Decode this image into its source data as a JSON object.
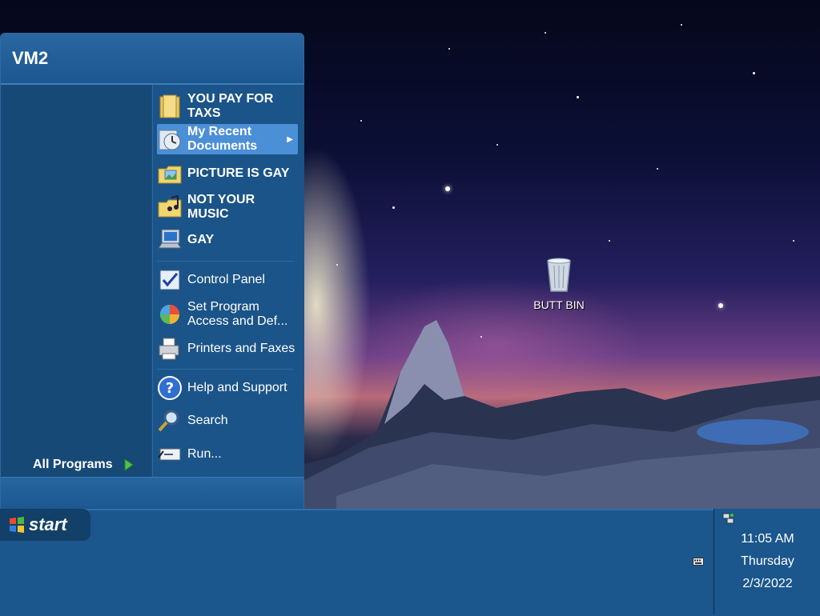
{
  "desktop": {
    "recycle_bin_label": "BUTT BIN"
  },
  "start_menu": {
    "user_name": "VM2",
    "all_programs_label": "All Programs",
    "right_items": [
      {
        "label": "YOU PAY FOR TAXS",
        "icon": "folder-icon",
        "bold": true
      },
      {
        "label": "My Recent Documents",
        "icon": "recent-documents-icon",
        "bold": true,
        "selected": true,
        "submenu": true
      },
      {
        "label": "PICTURE IS GAY",
        "icon": "pictures-folder-icon",
        "bold": true
      },
      {
        "label": "NOT YOUR MUSIC",
        "icon": "music-folder-icon",
        "bold": true
      },
      {
        "label": "GAY",
        "icon": "my-computer-icon",
        "bold": true
      },
      {
        "label": "Control Panel",
        "icon": "control-panel-icon"
      },
      {
        "label": "Set Program Access and Def...",
        "icon": "program-access-icon"
      },
      {
        "label": "Printers and Faxes",
        "icon": "printer-icon"
      },
      {
        "label": "Help and Support",
        "icon": "help-icon"
      },
      {
        "label": "Search",
        "icon": "search-icon"
      },
      {
        "label": "Run...",
        "icon": "run-icon"
      }
    ]
  },
  "taskbar": {
    "start_label": "start",
    "clock_time": "11:05 AM",
    "clock_day": "Thursday",
    "clock_date": "2/3/2022"
  }
}
